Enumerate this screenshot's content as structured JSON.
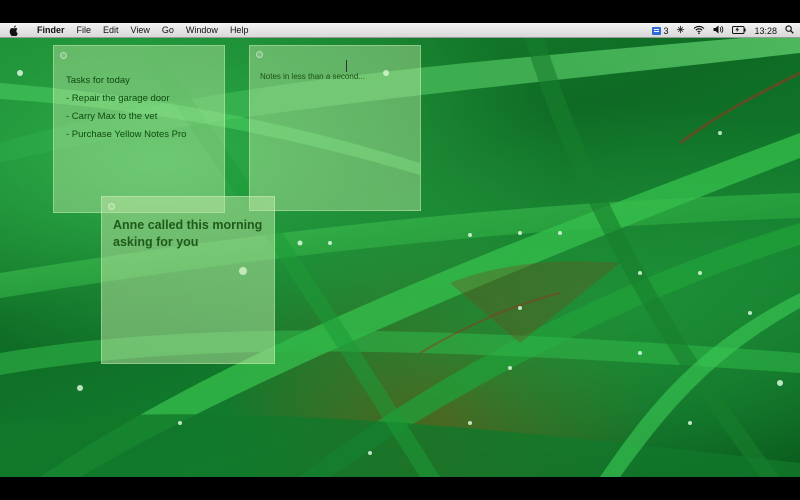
{
  "menubar": {
    "apple_icon": "apple-icon",
    "items": [
      "Finder",
      "File",
      "Edit",
      "View",
      "Go",
      "Window",
      "Help"
    ],
    "status": {
      "notes_count": "3",
      "time": "13:28"
    },
    "status_icons": [
      "notes-menu-icon",
      "bluetooth-icon",
      "wifi-icon",
      "volume-icon",
      "battery-icon",
      "spotlight-icon"
    ]
  },
  "notes": [
    {
      "lines": [
        "Tasks for today",
        "- Repair the garage door",
        "- Carry Max to the vet",
        "- Purchase Yellow Notes Pro"
      ]
    },
    {
      "lines": [
        "Notes in less than a second..."
      ]
    },
    {
      "lines": [
        "Anne called this morning",
        "asking for you"
      ]
    }
  ],
  "colors": {
    "note_fill": "#c4ebaa",
    "note_text_dark": "#0f4a10",
    "note_text_bold": "#1f5a1b",
    "grass": "#1a8a32"
  }
}
